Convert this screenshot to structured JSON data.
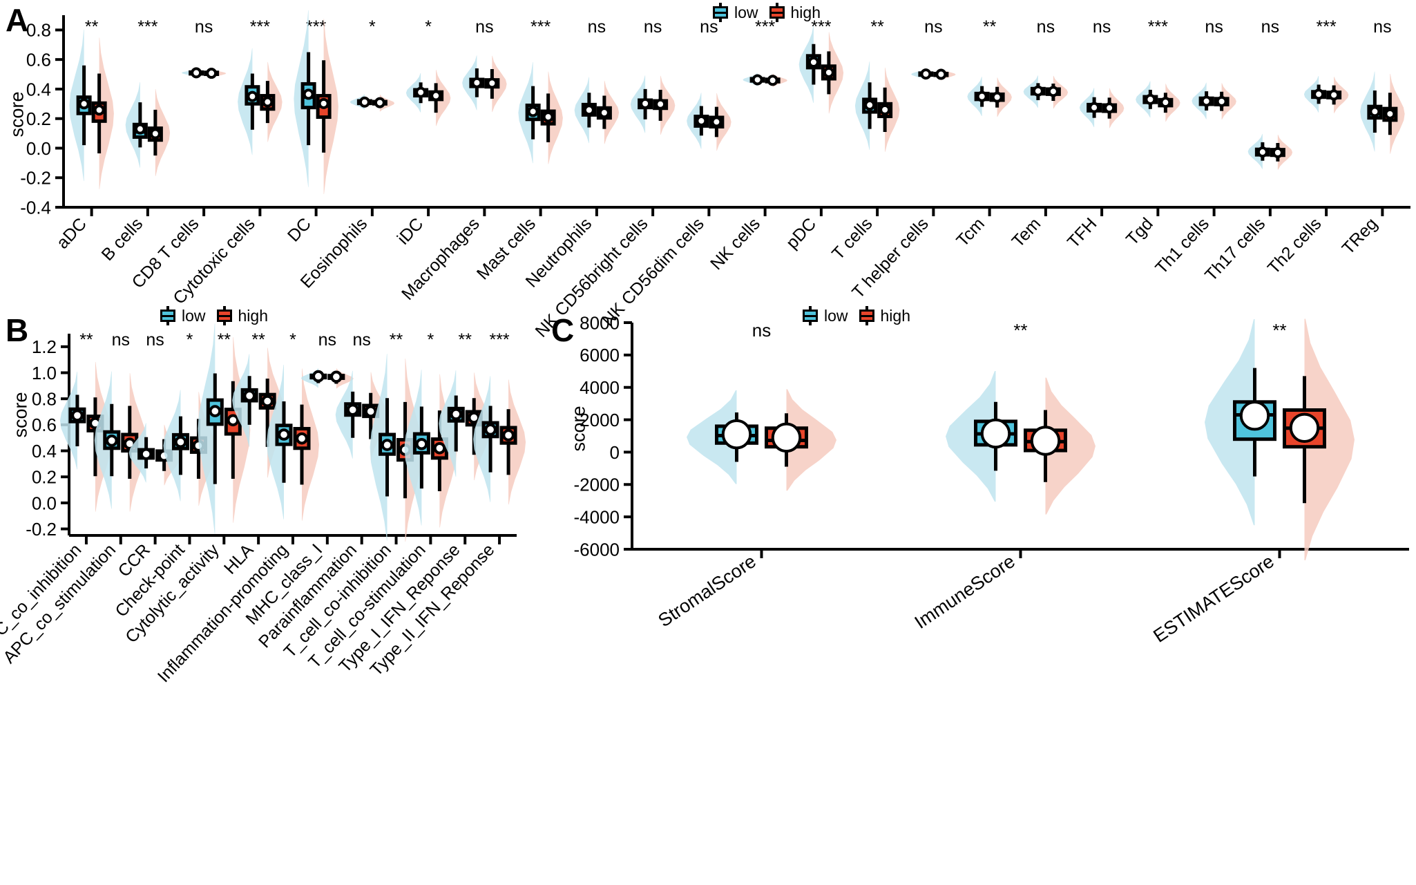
{
  "figure": {
    "panels": [
      "A",
      "B",
      "C"
    ],
    "legend": {
      "low_label": "low",
      "high_label": "high",
      "low_color": "#4FC3DC",
      "high_color": "#E8452B"
    },
    "axis_label": "score"
  },
  "chart_data": [
    {
      "panel": "A",
      "type": "box",
      "title": "",
      "xlabel": "",
      "ylabel": "score",
      "ylim": [
        -0.4,
        0.9
      ],
      "yticks": [
        -0.4,
        -0.2,
        0.0,
        0.2,
        0.4,
        0.6,
        0.8
      ],
      "ytick_labels": [
        "-0.4",
        "-0.2",
        "0.0",
        "0.2",
        "0.4",
        "0.6",
        "0.8"
      ],
      "grid": false,
      "legend_position": "top-right",
      "categories": [
        "aDC",
        "B cells",
        "CD8 T cells",
        "Cytotoxic cells",
        "DC",
        "Eosinophils",
        "iDC",
        "Macrophages",
        "Mast cells",
        "Neutrophils",
        "NK CD56bright cells",
        "NK CD56dim cells",
        "NK cells",
        "pDC",
        "T cells",
        "T helper cells",
        "Tcm",
        "Tem",
        "TFH",
        "Tgd",
        "Th1 cells",
        "Th17 cells",
        "Th2 cells",
        "TReg"
      ],
      "significance": [
        "**",
        "***",
        "ns",
        "***",
        "***",
        "*",
        "*",
        "ns",
        "***",
        "ns",
        "ns",
        "ns",
        "***",
        "***",
        "**",
        "ns",
        "**",
        "ns",
        "ns",
        "***",
        "ns",
        "ns",
        "***",
        "ns"
      ],
      "series": [
        {
          "name": "low",
          "color": "#4FC3DC",
          "boxes": [
            {
              "low": 0.02,
              "q1": 0.235,
              "median": 0.285,
              "mean": 0.3,
              "q3": 0.345,
              "high": 0.56
            },
            {
              "low": 0.005,
              "q1": 0.075,
              "median": 0.11,
              "mean": 0.13,
              "q3": 0.16,
              "high": 0.31
            },
            {
              "low": 0.495,
              "q1": 0.503,
              "median": 0.508,
              "mean": 0.51,
              "q3": 0.515,
              "high": 0.525
            },
            {
              "low": 0.125,
              "q1": 0.3,
              "median": 0.34,
              "mean": 0.35,
              "q3": 0.415,
              "high": 0.505
            },
            {
              "low": 0.02,
              "q1": 0.275,
              "median": 0.345,
              "mean": 0.365,
              "q3": 0.435,
              "high": 0.65
            },
            {
              "low": 0.285,
              "q1": 0.303,
              "median": 0.31,
              "mean": 0.312,
              "q3": 0.32,
              "high": 0.34
            },
            {
              "low": 0.305,
              "q1": 0.355,
              "median": 0.372,
              "mean": 0.378,
              "q3": 0.395,
              "high": 0.445
            },
            {
              "low": 0.345,
              "q1": 0.418,
              "median": 0.44,
              "mean": 0.443,
              "q3": 0.465,
              "high": 0.54
            },
            {
              "low": 0.06,
              "q1": 0.195,
              "median": 0.24,
              "mean": 0.248,
              "q3": 0.29,
              "high": 0.42
            },
            {
              "low": 0.14,
              "q1": 0.225,
              "median": 0.255,
              "mean": 0.258,
              "q3": 0.295,
              "high": 0.375
            },
            {
              "low": 0.195,
              "q1": 0.275,
              "median": 0.3,
              "mean": 0.302,
              "q3": 0.325,
              "high": 0.4
            },
            {
              "low": 0.085,
              "q1": 0.15,
              "median": 0.182,
              "mean": 0.185,
              "q3": 0.215,
              "high": 0.285
            },
            {
              "low": 0.44,
              "q1": 0.455,
              "median": 0.462,
              "mean": 0.463,
              "q3": 0.47,
              "high": 0.487
            },
            {
              "low": 0.43,
              "q1": 0.545,
              "median": 0.58,
              "mean": 0.582,
              "q3": 0.625,
              "high": 0.705
            },
            {
              "low": 0.13,
              "q1": 0.245,
              "median": 0.288,
              "mean": 0.292,
              "q3": 0.33,
              "high": 0.445
            },
            {
              "low": 0.48,
              "q1": 0.495,
              "median": 0.5,
              "mean": 0.502,
              "q3": 0.508,
              "high": 0.522
            },
            {
              "low": 0.28,
              "q1": 0.33,
              "median": 0.347,
              "mean": 0.35,
              "q3": 0.37,
              "high": 0.42
            },
            {
              "low": 0.325,
              "q1": 0.368,
              "median": 0.385,
              "mean": 0.387,
              "q3": 0.403,
              "high": 0.44
            },
            {
              "low": 0.205,
              "q1": 0.253,
              "median": 0.272,
              "mean": 0.275,
              "q3": 0.295,
              "high": 0.345
            },
            {
              "low": 0.265,
              "q1": 0.31,
              "median": 0.328,
              "mean": 0.33,
              "q3": 0.348,
              "high": 0.395
            },
            {
              "low": 0.255,
              "q1": 0.297,
              "median": 0.315,
              "mean": 0.318,
              "q3": 0.338,
              "high": 0.385
            },
            {
              "low": -0.085,
              "q1": -0.045,
              "median": -0.025,
              "mean": -0.026,
              "q3": -0.008,
              "high": 0.04
            },
            {
              "low": 0.3,
              "q1": 0.345,
              "median": 0.362,
              "mean": 0.365,
              "q3": 0.382,
              "high": 0.43
            },
            {
              "low": 0.105,
              "q1": 0.205,
              "median": 0.243,
              "mean": 0.248,
              "q3": 0.282,
              "high": 0.39
            }
          ]
        },
        {
          "name": "high",
          "color": "#E8452B",
          "boxes": [
            {
              "low": -0.035,
              "q1": 0.183,
              "median": 0.25,
              "mean": 0.258,
              "q3": 0.305,
              "high": 0.505
            },
            {
              "low": -0.05,
              "q1": 0.055,
              "median": 0.09,
              "mean": 0.098,
              "q3": 0.135,
              "high": 0.26
            },
            {
              "low": 0.49,
              "q1": 0.5,
              "median": 0.505,
              "mean": 0.507,
              "q3": 0.513,
              "high": 0.523
            },
            {
              "low": 0.17,
              "q1": 0.265,
              "median": 0.305,
              "mean": 0.313,
              "q3": 0.355,
              "high": 0.455
            },
            {
              "low": -0.03,
              "q1": 0.21,
              "median": 0.285,
              "mean": 0.302,
              "q3": 0.355,
              "high": 0.595
            },
            {
              "low": 0.275,
              "q1": 0.3,
              "median": 0.307,
              "mean": 0.308,
              "q3": 0.315,
              "high": 0.335
            },
            {
              "low": 0.24,
              "q1": 0.33,
              "median": 0.352,
              "mean": 0.355,
              "q3": 0.38,
              "high": 0.44
            },
            {
              "low": 0.335,
              "q1": 0.415,
              "median": 0.438,
              "mean": 0.44,
              "q3": 0.462,
              "high": 0.535
            },
            {
              "low": 0.04,
              "q1": 0.165,
              "median": 0.205,
              "mean": 0.212,
              "q3": 0.25,
              "high": 0.37
            },
            {
              "low": 0.13,
              "q1": 0.205,
              "median": 0.235,
              "mean": 0.24,
              "q3": 0.272,
              "high": 0.355
            },
            {
              "low": 0.185,
              "q1": 0.27,
              "median": 0.295,
              "mean": 0.298,
              "q3": 0.32,
              "high": 0.395
            },
            {
              "low": 0.075,
              "q1": 0.145,
              "median": 0.175,
              "mean": 0.178,
              "q3": 0.208,
              "high": 0.28
            },
            {
              "low": 0.435,
              "q1": 0.45,
              "median": 0.458,
              "mean": 0.459,
              "q3": 0.466,
              "high": 0.483
            },
            {
              "low": 0.365,
              "q1": 0.47,
              "median": 0.51,
              "mean": 0.512,
              "q3": 0.555,
              "high": 0.655
            },
            {
              "low": 0.11,
              "q1": 0.215,
              "median": 0.255,
              "mean": 0.26,
              "q3": 0.3,
              "high": 0.41
            },
            {
              "low": 0.478,
              "q1": 0.493,
              "median": 0.498,
              "mean": 0.5,
              "q3": 0.505,
              "high": 0.52
            },
            {
              "low": 0.275,
              "q1": 0.325,
              "median": 0.343,
              "mean": 0.345,
              "q3": 0.365,
              "high": 0.415
            },
            {
              "low": 0.32,
              "q1": 0.365,
              "median": 0.382,
              "mean": 0.384,
              "q3": 0.4,
              "high": 0.437
            },
            {
              "low": 0.2,
              "q1": 0.25,
              "median": 0.27,
              "mean": 0.272,
              "q3": 0.292,
              "high": 0.342
            },
            {
              "low": 0.24,
              "q1": 0.288,
              "median": 0.307,
              "mean": 0.31,
              "q3": 0.328,
              "high": 0.375
            },
            {
              "low": 0.252,
              "q1": 0.295,
              "median": 0.313,
              "mean": 0.316,
              "q3": 0.335,
              "high": 0.382
            },
            {
              "low": -0.09,
              "q1": -0.048,
              "median": -0.028,
              "mean": -0.03,
              "q3": -0.01,
              "high": 0.035
            },
            {
              "low": 0.295,
              "q1": 0.342,
              "median": 0.358,
              "mean": 0.36,
              "q3": 0.378,
              "high": 0.425
            },
            {
              "low": 0.09,
              "q1": 0.19,
              "median": 0.228,
              "mean": 0.232,
              "q3": 0.268,
              "high": 0.375
            }
          ]
        }
      ]
    },
    {
      "panel": "B",
      "type": "box",
      "title": "",
      "xlabel": "",
      "ylabel": "score",
      "ylim": [
        -0.25,
        1.3
      ],
      "yticks": [
        -0.2,
        0.0,
        0.2,
        0.4,
        0.6,
        0.8,
        1.0,
        1.2
      ],
      "ytick_labels": [
        "-0.2",
        "0.0",
        "0.2",
        "0.4",
        "0.6",
        "0.8",
        "1.0",
        "1.2"
      ],
      "grid": false,
      "legend_position": "top-right",
      "categories": [
        "APC_co_inhibition",
        "APC_co_stimulation",
        "CCR",
        "Check-point",
        "Cytolytic_activity",
        "HLA",
        "Inflammation-promoting",
        "MHC_class_I",
        "Parainflammation",
        "T_cell_co-inhibition",
        "T_cell_co-stimulation",
        "Type_I_IFN_Reponse",
        "Type_II_IFN_Reponse"
      ],
      "significance": [
        "**",
        "ns",
        "ns",
        "*",
        "**",
        "**",
        "*",
        "ns",
        "ns",
        "**",
        "*",
        "**",
        "***"
      ],
      "series": [
        {
          "name": "low",
          "color": "#4FC3DC",
          "boxes": [
            {
              "low": 0.435,
              "q1": 0.625,
              "median": 0.668,
              "mean": 0.672,
              "q3": 0.72,
              "high": 0.83
            },
            {
              "low": 0.205,
              "q1": 0.42,
              "median": 0.47,
              "mean": 0.478,
              "q3": 0.545,
              "high": 0.76
            },
            {
              "low": 0.265,
              "q1": 0.345,
              "median": 0.372,
              "mean": 0.375,
              "q3": 0.408,
              "high": 0.505
            },
            {
              "low": 0.215,
              "q1": 0.418,
              "median": 0.463,
              "mean": 0.468,
              "q3": 0.523,
              "high": 0.665
            },
            {
              "low": 0.145,
              "q1": 0.605,
              "median": 0.7,
              "mean": 0.705,
              "q3": 0.79,
              "high": 0.995
            },
            {
              "low": 0.6,
              "q1": 0.785,
              "median": 0.82,
              "mean": 0.823,
              "q3": 0.868,
              "high": 0.975
            },
            {
              "low": 0.155,
              "q1": 0.45,
              "median": 0.52,
              "mean": 0.525,
              "q3": 0.595,
              "high": 0.78
            },
            {
              "low": 0.92,
              "q1": 0.962,
              "median": 0.972,
              "mean": 0.973,
              "q3": 0.98,
              "high": 0.998
            },
            {
              "low": 0.5,
              "q1": 0.675,
              "median": 0.712,
              "mean": 0.715,
              "q3": 0.76,
              "high": 0.855
            },
            {
              "low": 0.05,
              "q1": 0.375,
              "median": 0.44,
              "mean": 0.445,
              "q3": 0.525,
              "high": 0.805
            },
            {
              "low": 0.11,
              "q1": 0.385,
              "median": 0.448,
              "mean": 0.452,
              "q3": 0.53,
              "high": 0.74
            },
            {
              "low": 0.395,
              "q1": 0.63,
              "median": 0.68,
              "mean": 0.682,
              "q3": 0.725,
              "high": 0.825
            },
            {
              "low": 0.235,
              "q1": 0.51,
              "median": 0.56,
              "mean": 0.563,
              "q3": 0.615,
              "high": 0.745
            }
          ]
        },
        {
          "name": "high",
          "color": "#E8452B",
          "boxes": [
            {
              "low": 0.205,
              "q1": 0.555,
              "median": 0.608,
              "mean": 0.612,
              "q3": 0.665,
              "high": 0.81
            },
            {
              "low": 0.185,
              "q1": 0.4,
              "median": 0.448,
              "mean": 0.455,
              "q3": 0.525,
              "high": 0.745
            },
            {
              "low": 0.245,
              "q1": 0.33,
              "median": 0.358,
              "mean": 0.362,
              "q3": 0.398,
              "high": 0.49
            },
            {
              "low": 0.185,
              "q1": 0.39,
              "median": 0.435,
              "mean": 0.44,
              "q3": 0.498,
              "high": 0.645
            },
            {
              "low": 0.185,
              "q1": 0.53,
              "median": 0.63,
              "mean": 0.635,
              "q3": 0.718,
              "high": 0.935
            },
            {
              "low": 0.43,
              "q1": 0.73,
              "median": 0.778,
              "mean": 0.782,
              "q3": 0.832,
              "high": 0.955
            },
            {
              "low": 0.14,
              "q1": 0.42,
              "median": 0.49,
              "mean": 0.495,
              "q3": 0.57,
              "high": 0.755
            },
            {
              "low": 0.915,
              "q1": 0.958,
              "median": 0.968,
              "mean": 0.969,
              "q3": 0.978,
              "high": 0.996
            },
            {
              "low": 0.49,
              "q1": 0.665,
              "median": 0.7,
              "mean": 0.703,
              "q3": 0.748,
              "high": 0.845
            },
            {
              "low": 0.035,
              "q1": 0.33,
              "median": 0.4,
              "mean": 0.408,
              "q3": 0.485,
              "high": 0.775
            },
            {
              "low": 0.09,
              "q1": 0.345,
              "median": 0.415,
              "mean": 0.42,
              "q3": 0.49,
              "high": 0.71
            },
            {
              "low": 0.37,
              "q1": 0.6,
              "median": 0.65,
              "mean": 0.655,
              "q3": 0.7,
              "high": 0.805
            },
            {
              "low": 0.215,
              "q1": 0.46,
              "median": 0.518,
              "mean": 0.52,
              "q3": 0.578,
              "high": 0.72
            }
          ]
        }
      ]
    },
    {
      "panel": "C",
      "type": "box",
      "title": "",
      "xlabel": "",
      "ylabel": "score",
      "ylim": [
        -6000,
        8000
      ],
      "yticks": [
        -6000,
        -4000,
        -2000,
        0,
        2000,
        4000,
        6000,
        8000
      ],
      "ytick_labels": [
        "-6000",
        "-4000",
        "-2000",
        "0",
        "2000",
        "4000",
        "6000",
        "8000"
      ],
      "grid": false,
      "legend_position": "top-right",
      "categories": [
        "StromalScore",
        "ImmuneScore",
        "ESTIMATEScore"
      ],
      "significance": [
        "ns",
        "**",
        "**"
      ],
      "series": [
        {
          "name": "low",
          "color": "#4FC3DC",
          "boxes": [
            {
              "low": -600,
              "q1": 560,
              "median": 1020,
              "mean": 1100,
              "q3": 1600,
              "high": 2450
            },
            {
              "low": -1150,
              "q1": 450,
              "median": 1130,
              "mean": 1150,
              "q3": 1900,
              "high": 3100
            },
            {
              "low": -1500,
              "q1": 800,
              "median": 2300,
              "mean": 2250,
              "q3": 3100,
              "high": 5200
            }
          ]
        },
        {
          "name": "high",
          "color": "#E8452B",
          "boxes": [
            {
              "low": -900,
              "q1": 330,
              "median": 720,
              "mean": 900,
              "q3": 1480,
              "high": 2400
            },
            {
              "low": -1850,
              "q1": 100,
              "median": 650,
              "mean": 700,
              "q3": 1350,
              "high": 2600
            },
            {
              "low": -3150,
              "q1": 330,
              "median": 1480,
              "mean": 1500,
              "q3": 2600,
              "high": 4700
            }
          ]
        }
      ]
    }
  ]
}
